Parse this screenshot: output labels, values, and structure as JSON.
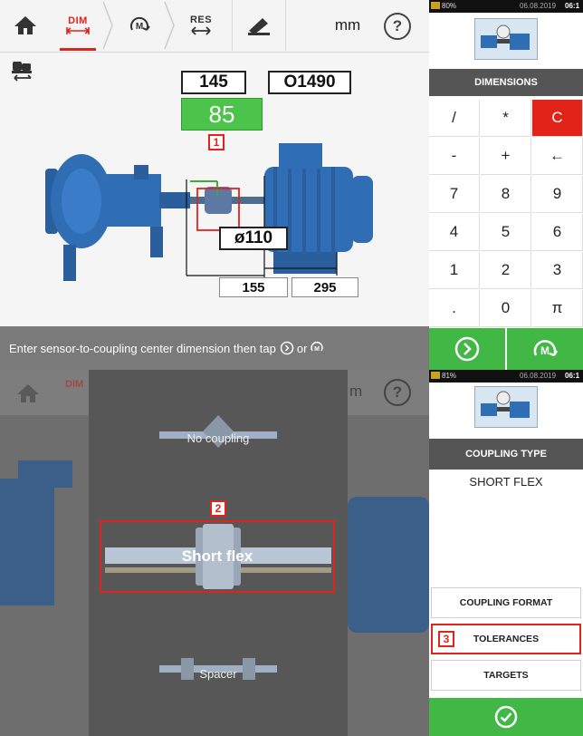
{
  "nav": {
    "home_icon": "home-icon",
    "dim_label": "DIM",
    "res_label": "RES",
    "unit": "mm",
    "help": "?",
    "measure_icon": "measure-m-icon",
    "machine_icon": "machine-icon",
    "swap_icon": "swap-machine-icon"
  },
  "stage": {
    "dim_top_left": "145",
    "dim_top_right": "O1490",
    "dim_green": "85",
    "tag1": "1",
    "coupling_dia": "ø110",
    "dim_bottom_left": "155",
    "dim_bottom_right": "295"
  },
  "status_text": "Enter sensor-to-coupling center dimension then tap",
  "status_or": "or",
  "right1": {
    "battery": "80%",
    "datetime": "06.08.2019",
    "time": "06:1",
    "title": "DIMENSIONS",
    "keys": [
      "/",
      "*",
      "C",
      "-",
      "+",
      "←",
      "7",
      "8",
      "9",
      "4",
      "5",
      "6",
      "1",
      "2",
      "3",
      ".",
      "0",
      "π"
    ]
  },
  "bottom": {
    "nav_dim": "DIM",
    "nav_unit": "m",
    "help": "?",
    "no_coupling": "No coupling",
    "short_flex": "Short flex",
    "spacer": "Spacer",
    "tag2": "2"
  },
  "right2": {
    "battery": "81%",
    "datetime": "06.08.2019",
    "time": "06:1",
    "title": "COUPLING TYPE",
    "selected": "SHORT FLEX",
    "btn_format": "COUPLING FORMAT",
    "btn_tolerances": "TOLERANCES",
    "btn_targets": "TARGETS",
    "tag3": "3"
  },
  "colors": {
    "accent_red": "#e2231a",
    "confirm_green": "#41b745",
    "value_green": "#4cc44c"
  }
}
